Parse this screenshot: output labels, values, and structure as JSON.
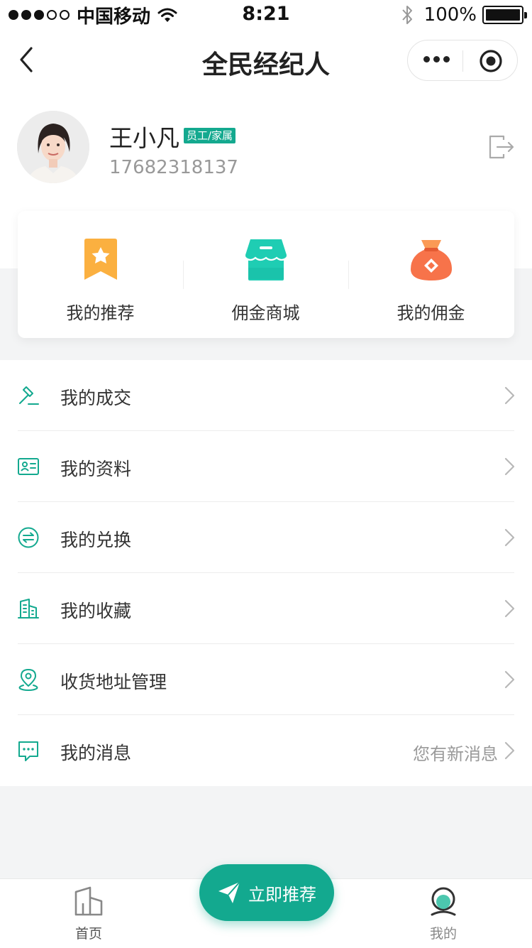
{
  "status_bar": {
    "carrier": "中国移动",
    "time": "8:21",
    "battery": "100%",
    "signal_bars_filled": 3,
    "signal_bars_total": 5
  },
  "nav": {
    "title": "全民经纪人",
    "back_icon": "chevron-left-icon",
    "more_icon": "more-dots-icon",
    "close_icon": "target-circle-icon"
  },
  "profile": {
    "name": "王小凡",
    "badge": "员工/家属",
    "phone": "17682318137",
    "logout_icon": "logout-icon"
  },
  "quick_actions": [
    {
      "label": "我的推荐",
      "icon": "bookmark-star-icon",
      "color": "#fbb040"
    },
    {
      "label": "佣金商城",
      "icon": "shop-icon",
      "color": "#1fcdb3"
    },
    {
      "label": "我的佣金",
      "icon": "money-bag-icon",
      "color": "#f7734a"
    }
  ],
  "menu": [
    {
      "label": "我的成交",
      "icon": "gavel-icon",
      "hint": ""
    },
    {
      "label": "我的资料",
      "icon": "id-card-icon",
      "hint": ""
    },
    {
      "label": "我的兑换",
      "icon": "exchange-icon",
      "hint": ""
    },
    {
      "label": "我的收藏",
      "icon": "building-icon",
      "hint": ""
    },
    {
      "label": "收货地址管理",
      "icon": "location-pin-icon",
      "hint": ""
    },
    {
      "label": "我的消息",
      "icon": "message-icon",
      "hint": "您有新消息"
    }
  ],
  "tab_bar": {
    "home": {
      "label": "首页",
      "icon": "home-building-icon"
    },
    "recommend": {
      "label": "立即推荐",
      "icon": "paper-plane-icon"
    },
    "me": {
      "label": "我的",
      "icon": "user-profile-icon"
    }
  },
  "colors": {
    "accent": "#13a98f",
    "background": "#f3f4f5",
    "text": "#333333",
    "muted": "#999999"
  }
}
